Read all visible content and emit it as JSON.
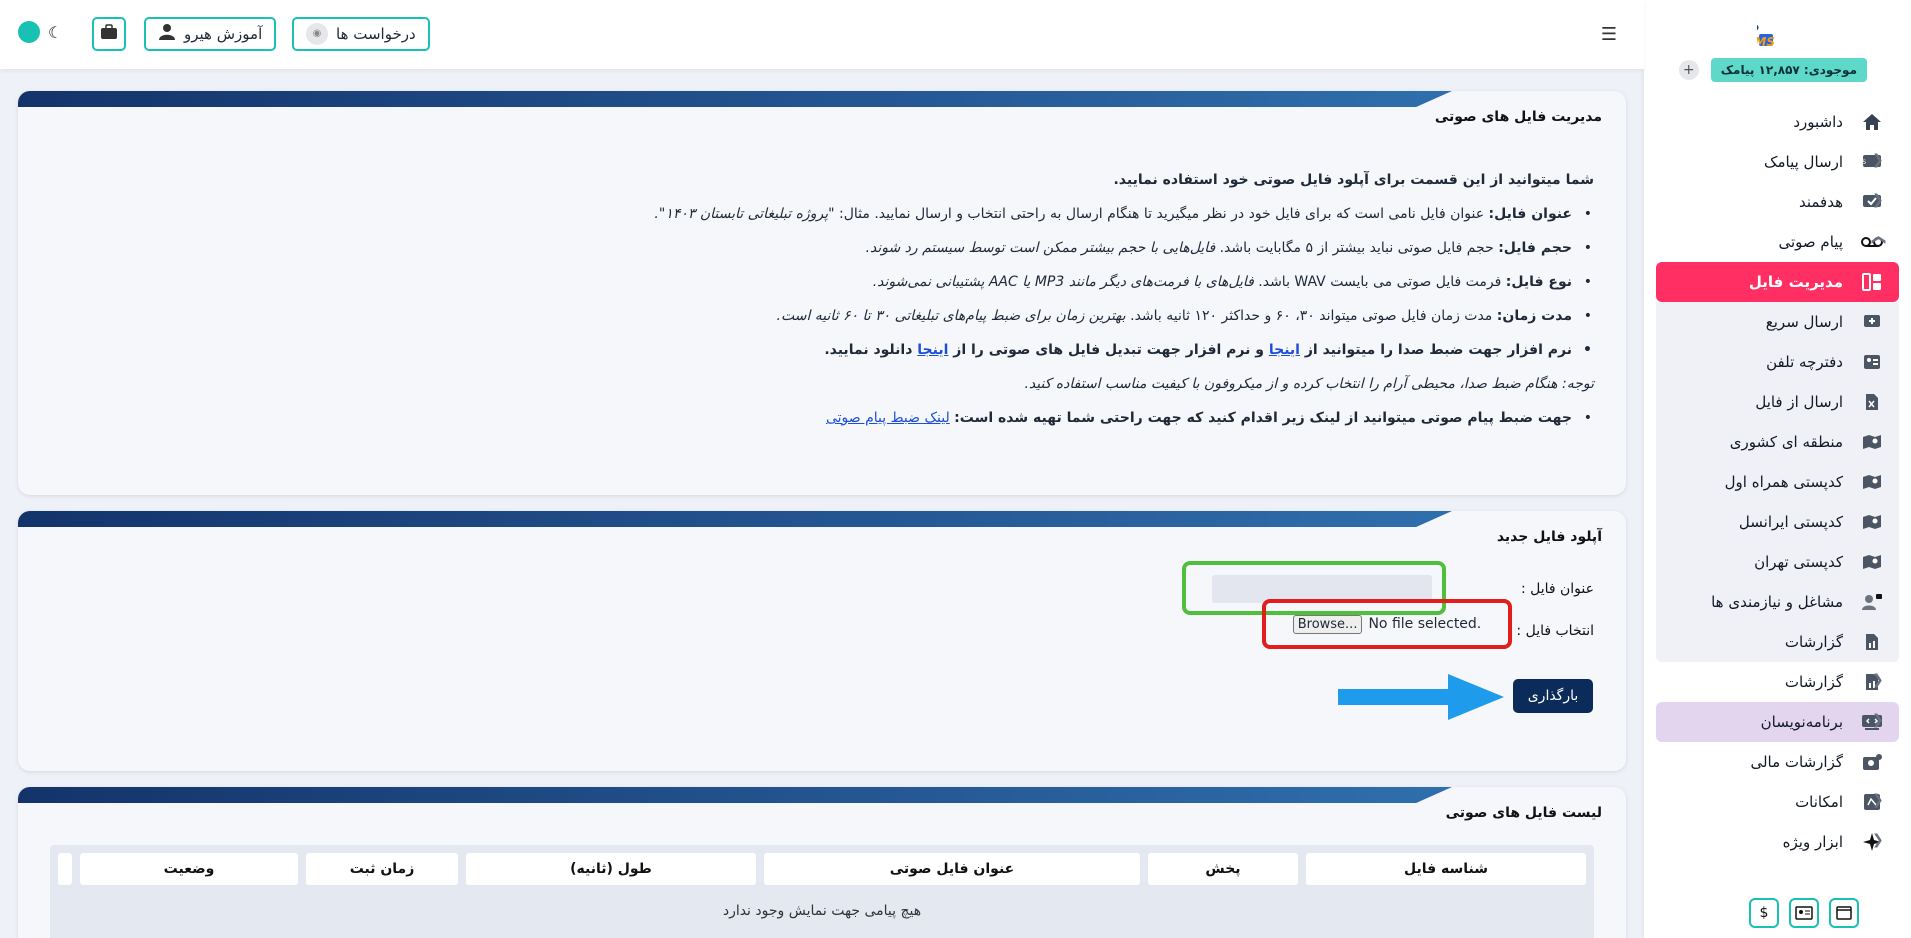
{
  "sidebar": {
    "logo_alt": "hiro SMS",
    "balance": "موجودی: ۱۲,۸۵۷ پیامک",
    "balance_add": "+",
    "items": [
      {
        "label": "داشبورد",
        "icon": "home-icon"
      },
      {
        "label": "ارسال پیامک",
        "icon": "sms-icon",
        "chevron": true
      },
      {
        "label": "هدفمند",
        "icon": "target-icon",
        "chevron": true
      },
      {
        "label": "پیام صوتی",
        "icon": "voicemail-icon",
        "chevron": true
      }
    ],
    "active": {
      "label": "مدیریت فایل",
      "icon": "file-manager-icon"
    },
    "sub_items": [
      {
        "label": "ارسال سریع",
        "icon": "quick-send-icon"
      },
      {
        "label": "دفترچه تلفن",
        "icon": "phonebook-icon"
      },
      {
        "label": "ارسال از فایل",
        "icon": "excel-icon"
      },
      {
        "label": "منطقه ای کشوری",
        "icon": "map-icon"
      },
      {
        "label": "کدپستی همراه اول",
        "icon": "map-icon"
      },
      {
        "label": "کدپستی ایرانسل",
        "icon": "map-icon"
      },
      {
        "label": "کدپستی تهران",
        "icon": "map-icon"
      },
      {
        "label": "مشاغل و نیازمندی ها",
        "icon": "jobs-icon"
      },
      {
        "label": "گزارشات",
        "icon": "report-icon"
      }
    ],
    "items2": [
      {
        "label": "گزارشات",
        "icon": "report-icon",
        "chevron": true
      }
    ],
    "developers": {
      "label": "برنامه‌نویسان",
      "icon": "code-icon"
    },
    "items3": [
      {
        "label": "گزارشات مالی",
        "icon": "finance-icon"
      },
      {
        "label": "امکانات",
        "icon": "features-icon",
        "chevron": true
      },
      {
        "label": "ابزار ویژه",
        "icon": "sparkle-icon",
        "chevron": true
      }
    ],
    "footer_icons": [
      "window-icon",
      "contact-card-icon",
      "dollar-icon"
    ]
  },
  "topbar": {
    "requests": "درخواست ها",
    "training": "آموزش هیرو"
  },
  "card1": {
    "title": "مدیریت فایل های صوتی",
    "intro": "شما میتوانید از این قسمت برای آپلود فایل صوتی خود استفاده نمایید.",
    "b1_label": "عنوان فایل:",
    "b1_text": " عنوان فایل نامی است که برای فایل خود در نظر میگیرید تا هنگام ارسال به راحتی انتخاب و ارسال نمایید. مثال: ",
    "b1_example": "\"پروژه تبلیغاتی تابستان ۱۴۰۳\".",
    "b2_label": "حجم فایل:",
    "b2_text": " حجم فایل صوتی نباید بیشتر از ۵ مگابایت باشد. ",
    "b2_italic": "فایل‌هایی با حجم بیشتر ممکن است توسط سیستم رد شوند.",
    "b3_label": "نوع فایل:",
    "b3_text": " فرمت فایل صوتی می بایست WAV باشد. ",
    "b3_italic": "فایل‌های با فرمت‌های دیگر مانند MP3 یا AAC پشتیبانی نمی‌شوند.",
    "b4_label": "مدت زمان:",
    "b4_text": " مدت زمان فایل صوتی میتواند ۳۰، ۶۰ و حداکثر ۱۲۰ ثانیه باشد. ",
    "b4_italic": "بهترین زمان برای ضبط پیام‌های تبلیغاتی ۳۰ تا ۶۰ ثانیه است.",
    "b5_a": "نرم افزار جهت ضبط صدا را میتوانید از ",
    "b5_link1": "اینجا",
    "b5_b": " و نرم افزار جهت تبدیل فایل های صوتی را از ",
    "b5_link2": "اینجا",
    "b5_c": " دانلود نمایید.",
    "note": "توجه: هنگام ضبط صدا، محیطی آرام را انتخاب کرده و از میکروفون با کیفیت مناسب استفاده کنید.",
    "b6_text": "جهت ضبط پیام صوتی میتوانید از لینک زیر اقدام کنید که جهت راحتی شما تهیه شده است:",
    "b6_link": "لینک ضبط پیام صوتی"
  },
  "card2": {
    "title": "آپلود فایل جدید",
    "title_label": "عنوان فایل :",
    "file_label": "انتخاب فایل :",
    "browse": "Browse...",
    "no_file": "No file selected.",
    "upload": "بارگذاری",
    "colors": {
      "title_highlight": "#4fbf3d",
      "file_highlight": "#e11d1d",
      "arrow": "#1e9bea"
    }
  },
  "card3": {
    "title": "لیست فایل های صوتی",
    "columns": [
      "شناسه فایل",
      "پخش",
      "عنوان فایل صوتی",
      "طول (ثانیه)",
      "زمان ثبت",
      "وضعیت",
      ""
    ],
    "empty": "هیچ پیامی جهت نمایش وجود ندارد"
  },
  "colors": {
    "accent": "#19c1b4",
    "active": "#ff2e63",
    "primary": "#0b2c5a"
  }
}
